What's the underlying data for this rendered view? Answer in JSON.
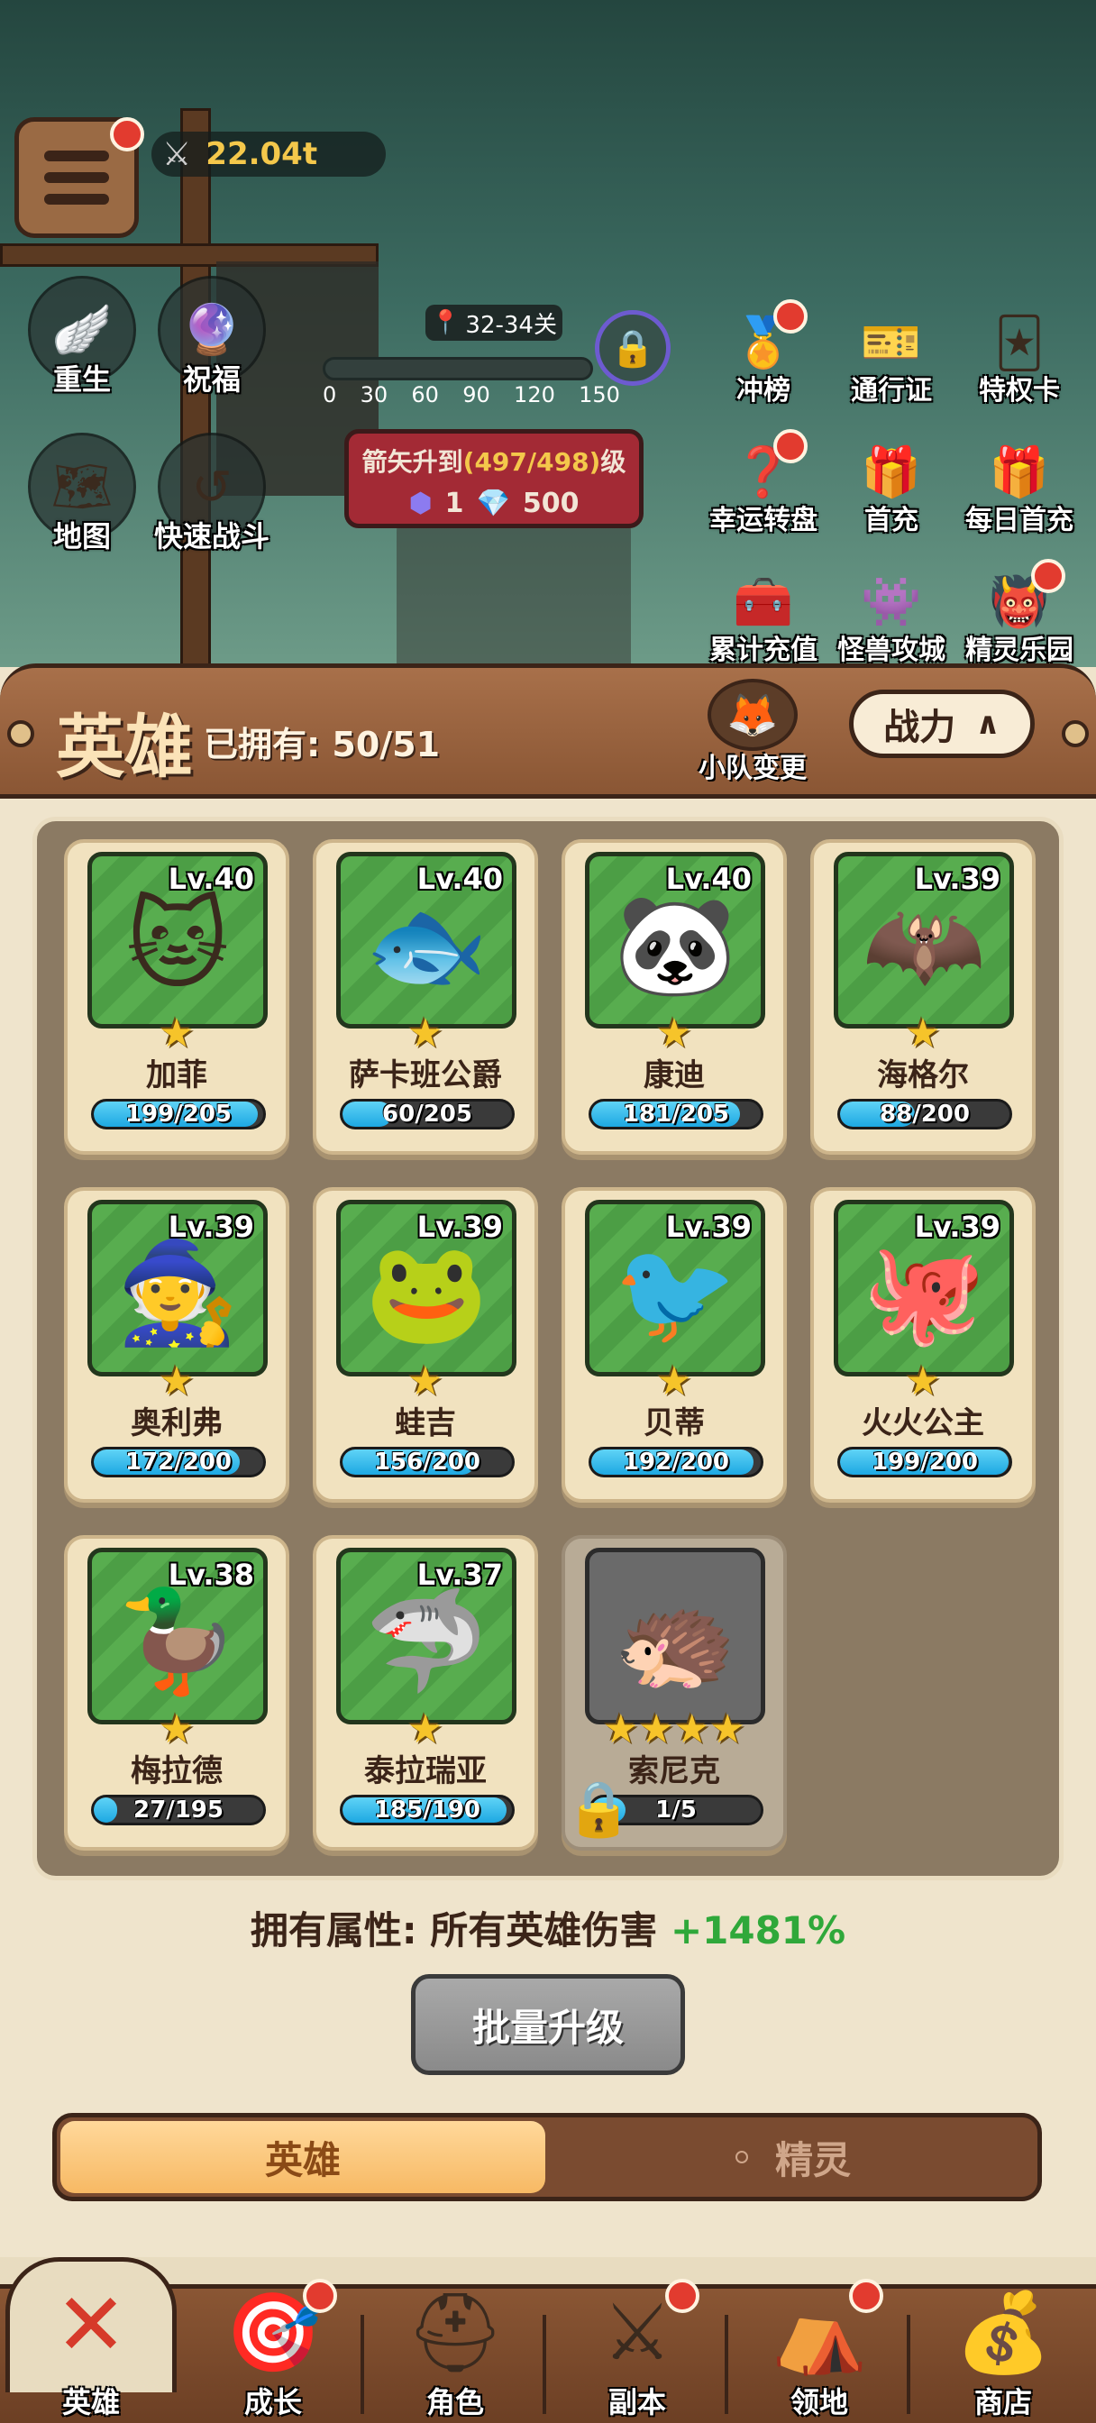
{
  "top": {
    "power_value": "22.04t",
    "left_buttons": [
      {
        "label": "重生",
        "icon": "wings-chest-icon"
      },
      {
        "label": "祝福",
        "icon": "orbs-icon"
      },
      {
        "label": "地图",
        "icon": "map-icon"
      },
      {
        "label": "快速战斗",
        "icon": "fast-forward-icon"
      }
    ],
    "stage": {
      "label": "32-34关",
      "ticks": [
        "0",
        "30",
        "60",
        "90",
        "120",
        "150"
      ],
      "progress": 0.0
    },
    "arrow_upgrade": {
      "text_prefix": "箭矢升到",
      "text_highlight": "(497/498)",
      "text_suffix": "级",
      "cost_purple": "1",
      "cost_blue": "500"
    },
    "right_features": [
      {
        "label": "冲榜",
        "icon": "trophy-icon",
        "badge": true
      },
      {
        "label": "通行证",
        "icon": "ticket-icon",
        "badge": false
      },
      {
        "label": "特权卡",
        "icon": "card-icon",
        "badge": false
      },
      {
        "label": "幸运转盘",
        "icon": "wheel-icon",
        "badge": true
      },
      {
        "label": "首充",
        "icon": "gift-icon",
        "badge": false
      },
      {
        "label": "每日首充",
        "icon": "present-icon",
        "badge": false
      },
      {
        "label": "累计充值",
        "icon": "chest-icon",
        "badge": false
      },
      {
        "label": "怪兽攻城",
        "icon": "monster-icon",
        "badge": false
      },
      {
        "label": "精灵乐园",
        "icon": "spirit-icon",
        "badge": true
      }
    ]
  },
  "header": {
    "title": "英雄",
    "owned": "已拥有:  50/51",
    "team_label": "小队变更",
    "sort_label": "战力",
    "sort_icon": "chevron-up-icon"
  },
  "heroes": [
    {
      "name": "加菲",
      "level": "Lv.40",
      "progress": "199/205",
      "ratio": 0.97,
      "face": "🐱",
      "stars": "★",
      "locked": false
    },
    {
      "name": "萨卡班公爵",
      "level": "Lv.40",
      "progress": "60/205",
      "ratio": 0.29,
      "face": "🐟",
      "stars": "★",
      "locked": false
    },
    {
      "name": "康迪",
      "level": "Lv.40",
      "progress": "181/205",
      "ratio": 0.88,
      "face": "🐼",
      "stars": "★",
      "locked": false
    },
    {
      "name": "海格尔",
      "level": "Lv.39",
      "progress": "88/200",
      "ratio": 0.44,
      "face": "🦇",
      "stars": "★",
      "locked": false
    },
    {
      "name": "奥利弗",
      "level": "Lv.39",
      "progress": "172/200",
      "ratio": 0.86,
      "face": "🧙",
      "stars": "★",
      "locked": false
    },
    {
      "name": "蛙吉",
      "level": "Lv.39",
      "progress": "156/200",
      "ratio": 0.78,
      "face": "🐸",
      "stars": "★",
      "locked": false
    },
    {
      "name": "贝蒂",
      "level": "Lv.39",
      "progress": "192/200",
      "ratio": 0.96,
      "face": "🐦",
      "stars": "★",
      "locked": false
    },
    {
      "name": "火火公主",
      "level": "Lv.39",
      "progress": "199/200",
      "ratio": 0.995,
      "face": "🐙",
      "stars": "★",
      "locked": false
    },
    {
      "name": "梅拉德",
      "level": "Lv.38",
      "progress": "27/195",
      "ratio": 0.14,
      "face": "🦆",
      "stars": "★",
      "locked": false
    },
    {
      "name": "泰拉瑞亚",
      "level": "Lv.37",
      "progress": "185/190",
      "ratio": 0.97,
      "face": "🦈",
      "stars": "★",
      "locked": false
    },
    {
      "name": "索尼克",
      "level": "",
      "progress": "1/5",
      "ratio": 0.2,
      "face": "🦔",
      "stars": "★★★★",
      "locked": true
    }
  ],
  "attribute": {
    "prefix": "拥有属性: 所有英雄伤害 ",
    "value": "+1481%"
  },
  "batch_upgrade_label": "批量升级",
  "toggle": {
    "active": "英雄",
    "inactive": "精灵"
  },
  "tabs": [
    {
      "label": "英雄",
      "icon": "close-icon",
      "active": true
    },
    {
      "label": "成长",
      "icon": "target-icon",
      "badge": true
    },
    {
      "label": "角色",
      "icon": "helmet-icon"
    },
    {
      "label": "副本",
      "icon": "swords-icon",
      "badge": true
    },
    {
      "label": "领地",
      "icon": "tent-icon",
      "badge": true
    },
    {
      "label": "商店",
      "icon": "treasure-chest-icon"
    }
  ],
  "colors": {
    "accent_green": "#2fa83a",
    "wood": "#8a5634",
    "highlight_yellow": "#f4c84b",
    "badge_red": "#e23b2f"
  }
}
